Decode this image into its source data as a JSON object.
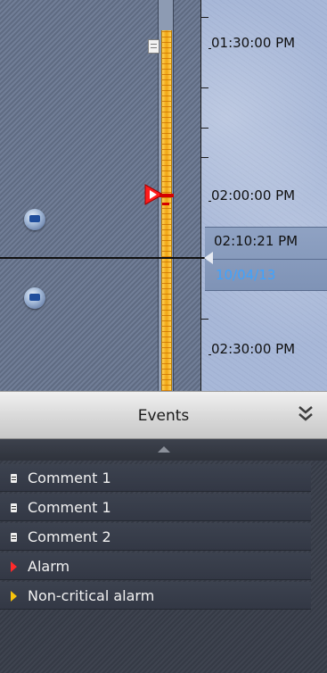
{
  "timeline": {
    "ticks": [
      "01:30:00 PM",
      "02:00:00 PM",
      "02:30:00 PM"
    ],
    "cursor": {
      "time": "02:10:21 PM",
      "date": "10/04/13"
    },
    "markers": {
      "comment_icon": "comment-marker-icon",
      "alarm_icon": "alarm-flag-icon"
    },
    "colors": {
      "track": "#f3b418",
      "alarm": "#ff2a2a",
      "date_text": "#3ea3ff"
    }
  },
  "events": {
    "title": "Events",
    "collapse_icon": "double-chevron-down-icon",
    "items": [
      {
        "label": "Comment 1",
        "icon": "comment-icon"
      },
      {
        "label": "Comment 1",
        "icon": "comment-icon"
      },
      {
        "label": "Comment 2",
        "icon": "comment-icon"
      },
      {
        "label": "Alarm",
        "icon": "alarm-icon",
        "color": "#ff2a2a"
      },
      {
        "label": "Non-critical alarm",
        "icon": "noncritical-alarm-icon",
        "color": "#f7c30c"
      }
    ]
  }
}
